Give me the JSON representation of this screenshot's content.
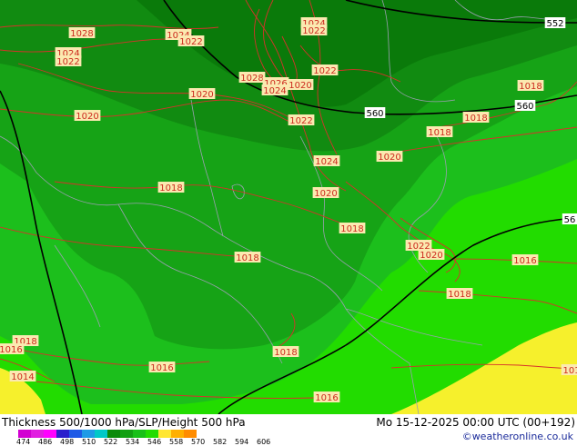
{
  "title": "Thickness 500/1000 hPa/SLP/Height 500 hPa",
  "datetime": "Mo 15-12-2025 00:00 UTC (00+192)",
  "credit": "©weatheronline.co.uk",
  "legend": {
    "ticks": [
      "474",
      "486",
      "498",
      "510",
      "522",
      "534",
      "546",
      "558",
      "570",
      "582",
      "594",
      "606"
    ],
    "colors": [
      "#d200d2",
      "#e11ee1",
      "#ff00ff",
      "#2a1ecc",
      "#1e5ae6",
      "#1e9ae6",
      "#00c8c8",
      "#0a8a0a",
      "#12a012",
      "#18c018",
      "#22dc00",
      "#ffe632",
      "#ffb000",
      "#ff8c00"
    ]
  },
  "map_colors": {
    "darkest_green": "#0a7a0a",
    "dark_green": "#118b11",
    "mid_green": "#16a316",
    "light_green": "#1cbf1c",
    "bright_green": "#22dc00",
    "yellow": "#f6f02c",
    "isobar": "#d7322a",
    "height_line": "#000000",
    "border": "#9aa0b0"
  },
  "pressure_labels": [
    {
      "text": "1028"
    },
    {
      "text": "1024"
    },
    {
      "text": "1022"
    },
    {
      "text": "1024"
    },
    {
      "text": "1022"
    },
    {
      "text": "1024"
    },
    {
      "text": "1022"
    },
    {
      "text": "1022"
    },
    {
      "text": "1028"
    },
    {
      "text": "1026"
    },
    {
      "text": "1024"
    },
    {
      "text": "1020"
    },
    {
      "text": "1020"
    },
    {
      "text": "1020"
    },
    {
      "text": "1022"
    },
    {
      "text": "1018"
    },
    {
      "text": "1018"
    },
    {
      "text": "1018"
    },
    {
      "text": "1024"
    },
    {
      "text": "1020"
    },
    {
      "text": "1020"
    },
    {
      "text": "1018"
    },
    {
      "text": "1018"
    },
    {
      "text": "1022"
    },
    {
      "text": "1020"
    },
    {
      "text": "1016"
    },
    {
      "text": "1018"
    },
    {
      "text": "1018"
    },
    {
      "text": "1018"
    },
    {
      "text": "1016"
    },
    {
      "text": "1018"
    },
    {
      "text": "1016"
    },
    {
      "text": "1014"
    },
    {
      "text": "1016"
    },
    {
      "text": "1016"
    },
    {
      "text": "101"
    }
  ],
  "height_labels": [
    {
      "text": "552"
    },
    {
      "text": "560"
    },
    {
      "text": "560"
    },
    {
      "text": "56"
    }
  ]
}
